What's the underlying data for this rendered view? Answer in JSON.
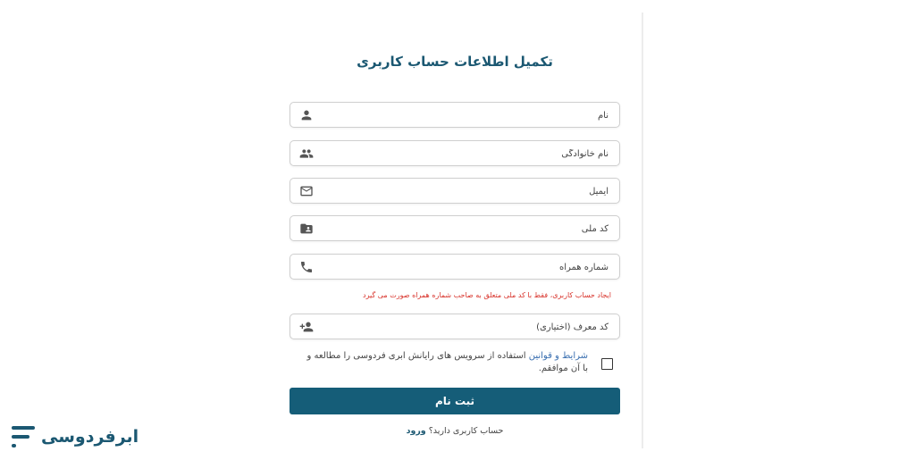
{
  "form": {
    "title": "تکمیل اطلاعات حساب کاربری",
    "fields": [
      {
        "placeholder": "نام",
        "icon": "person-icon"
      },
      {
        "placeholder": "نام خانوادگی",
        "icon": "group-icon"
      },
      {
        "placeholder": "ایمیل",
        "icon": "mail-icon"
      },
      {
        "placeholder": "کد ملی",
        "icon": "id-folder-icon"
      },
      {
        "placeholder": "شماره همراه",
        "icon": "phone-icon"
      },
      {
        "placeholder": "کد معرف (اختیاری)",
        "icon": "person-add-icon"
      }
    ],
    "warning": "ایجاد حساب کاربری، فقط با کد ملی متعلق به صاحب شماره همراه صورت می گیرد",
    "terms_link": "شرایط و قوانین",
    "terms_text": " استفاده از سرویس های رایانش ابری فردوسی را مطالعه و با آن موافقم.",
    "submit_label": "ثبت نام",
    "login_prompt": "حساب کاربری دارید؟ ",
    "login_link": "ورود"
  },
  "brand": {
    "name": "ابرفردوسی",
    "color": "#1b5872",
    "logo_icon": "ferdowsi-logo-mark"
  },
  "colors": {
    "primary": "#155d78",
    "warning": "#d8332b",
    "link": "#3a6fb0"
  }
}
